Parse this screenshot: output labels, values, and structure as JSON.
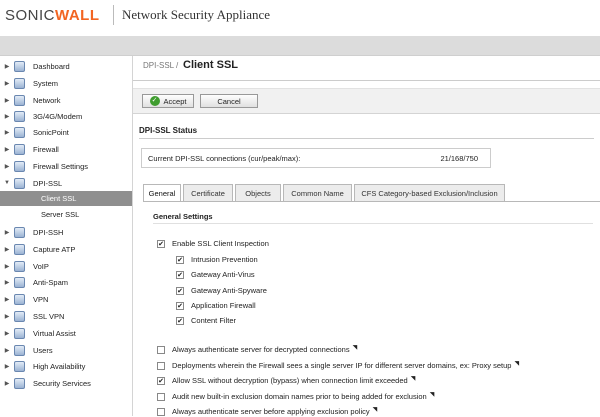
{
  "header": {
    "logo_a": "SONIC",
    "logo_b": "WALL",
    "product": "Network Security Appliance"
  },
  "sidebar": {
    "items": [
      {
        "label": "Dashboard",
        "expanded": false
      },
      {
        "label": "System",
        "expanded": false
      },
      {
        "label": "Network",
        "expanded": false
      },
      {
        "label": "3G/4G/Modem",
        "expanded": false
      },
      {
        "label": "SonicPoint",
        "expanded": false
      },
      {
        "label": "Firewall",
        "expanded": false
      },
      {
        "label": "Firewall Settings",
        "expanded": false
      },
      {
        "label": "DPI-SSL",
        "expanded": true
      },
      {
        "label": "DPI-SSH",
        "expanded": false
      },
      {
        "label": "Capture ATP",
        "expanded": false
      },
      {
        "label": "VoIP",
        "expanded": false
      },
      {
        "label": "Anti-Spam",
        "expanded": false
      },
      {
        "label": "VPN",
        "expanded": false
      },
      {
        "label": "SSL VPN",
        "expanded": false
      },
      {
        "label": "Virtual Assist",
        "expanded": false
      },
      {
        "label": "Users",
        "expanded": false
      },
      {
        "label": "High Availability",
        "expanded": false
      },
      {
        "label": "Security Services",
        "expanded": false
      }
    ],
    "subitems": [
      {
        "label": "Client SSL",
        "active": true
      },
      {
        "label": "Server SSL",
        "active": false
      }
    ]
  },
  "main": {
    "breadcrumb": "DPI-SSL /",
    "title": "Client SSL",
    "accept_label": "Accept",
    "cancel_label": "Cancel",
    "status_title": "DPI-SSL Status",
    "status_label": "Current DPI-SSL connections (cur/peak/max):",
    "status_value": "21/168/750",
    "tabs": [
      "General",
      "Certificate",
      "Objects",
      "Common Name",
      "CFS Category-based Exclusion/Inclusion"
    ],
    "active_tab": "General",
    "general_settings_title": "General Settings",
    "options": [
      {
        "label": "Enable SSL Client Inspection",
        "checked": true
      },
      {
        "label": "Intrusion Prevention",
        "checked": true
      },
      {
        "label": "Gateway Anti-Virus",
        "checked": true
      },
      {
        "label": "Gateway Anti-Spyware",
        "checked": true
      },
      {
        "label": "Application Firewall",
        "checked": true
      },
      {
        "label": "Content Filter",
        "checked": true
      },
      {
        "label": "Always authenticate server for decrypted connections",
        "checked": false
      },
      {
        "label": "Deployments wherein the Firewall sees a single server IP for different server domains, ex: Proxy setup",
        "checked": false
      },
      {
        "label": "Allow SSL without decryption (bypass) when connection limit exceeded",
        "checked": true
      },
      {
        "label": "Audit new built-in exclusion domain names prior to being added for exclusion",
        "checked": false
      },
      {
        "label": "Always authenticate server before applying exclusion policy",
        "checked": false
      }
    ]
  }
}
